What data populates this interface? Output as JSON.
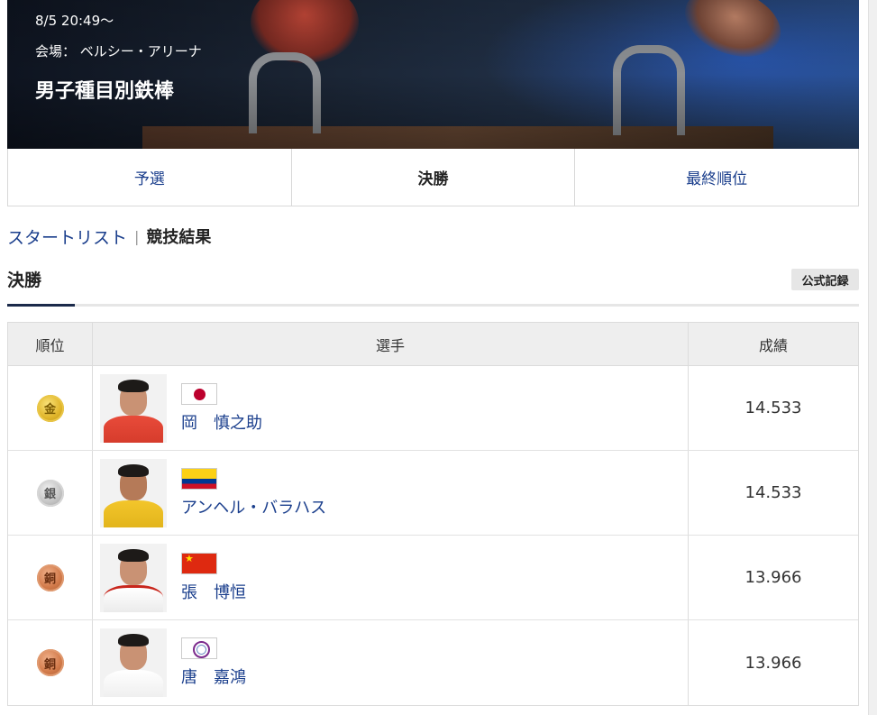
{
  "hero": {
    "date": "8/5 20:49〜",
    "venue": "会場： ベルシー・アリーナ",
    "event": "男子種目別鉄棒"
  },
  "tabs": [
    {
      "label": "予選",
      "active": false
    },
    {
      "label": "決勝",
      "active": true
    },
    {
      "label": "最終順位",
      "active": false
    }
  ],
  "subnav": {
    "start_list": "スタートリスト",
    "separator": "|",
    "results": "競技結果"
  },
  "section": {
    "title": "決勝",
    "badge": "公式記録"
  },
  "table": {
    "headers": {
      "rank": "順位",
      "athlete": "選手",
      "score": "成績"
    },
    "rows": [
      {
        "medal": "金",
        "medal_type": "gold",
        "flag": "japan-flag-icon",
        "name": "岡　慎之助",
        "score": "14.533"
      },
      {
        "medal": "銀",
        "medal_type": "silver",
        "flag": "colombia-flag-icon",
        "name": "アンヘル・バラハス",
        "score": "14.533"
      },
      {
        "medal": "銅",
        "medal_type": "bronze",
        "flag": "china-flag-icon",
        "name": "張　博恒",
        "score": "13.966"
      },
      {
        "medal": "銅",
        "medal_type": "bronze",
        "flag": "chinese-taipei-flag-icon",
        "name": "唐　嘉鴻",
        "score": "13.966"
      }
    ]
  },
  "colors": {
    "link": "#1a3e8c",
    "gold": "#e1b62b",
    "silver": "#c4c4c4",
    "bronze": "#d27a4a",
    "accent_underline": "#1b2a4a"
  }
}
